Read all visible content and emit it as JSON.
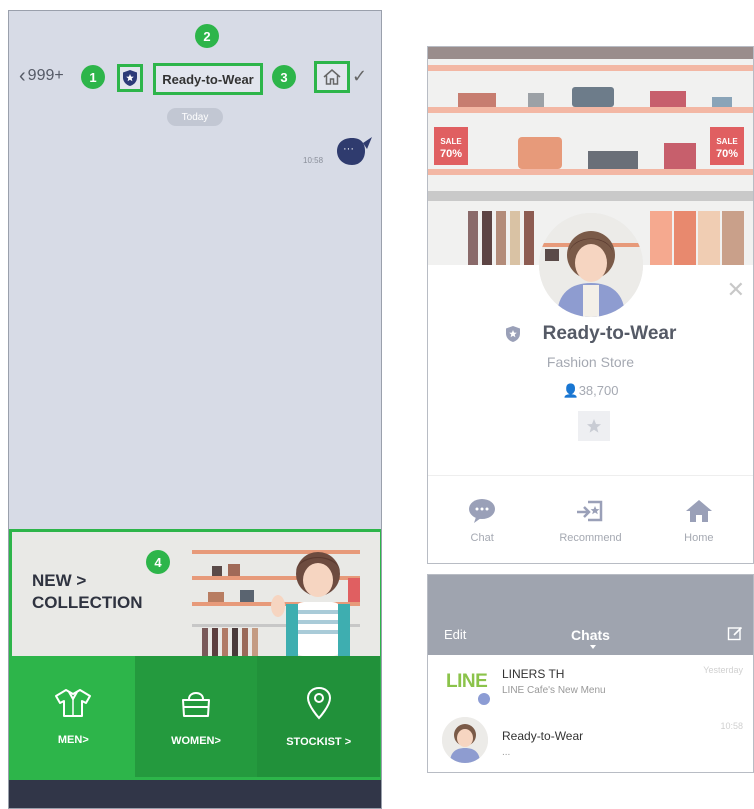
{
  "chat": {
    "back_label": "999+",
    "title": "Ready-to-Wear",
    "today_label": "Today",
    "message_time": "10:58",
    "message_text": "···"
  },
  "callouts": [
    "1",
    "2",
    "3",
    "4"
  ],
  "richmenu": {
    "banner_line1": "NEW >",
    "banner_line2": "COLLECTION",
    "buttons": [
      {
        "label": "MEN>",
        "icon": "shirt-icon"
      },
      {
        "label": "WOMEN>",
        "icon": "handbag-icon"
      },
      {
        "label": "STOCKIST >",
        "icon": "location-pin-icon"
      }
    ]
  },
  "profile": {
    "name": "Ready-to-Wear",
    "category": "Fashion Store",
    "followers": "38,700",
    "sale_tag_top": "SALE",
    "sale_tag_bottom": "70%",
    "actions": [
      {
        "label": "Chat",
        "icon": "chat-icon"
      },
      {
        "label": "Recommend",
        "icon": "recommend-icon"
      },
      {
        "label": "Home",
        "icon": "home-icon"
      }
    ]
  },
  "chatlist": {
    "edit_label": "Edit",
    "title": "Chats",
    "rows": [
      {
        "logo": "LINE",
        "name": "LINERS TH",
        "subtitle": "LINE Cafe's New Menu",
        "time": "Yesterday"
      },
      {
        "name": "Ready-to-Wear",
        "subtitle": "...",
        "time": "10:58"
      }
    ]
  },
  "colors": {
    "accent_green": "#2db54a",
    "chat_bg": "#d7dbe6",
    "header_gray": "#9fa4af",
    "dark_bar": "#313648"
  }
}
